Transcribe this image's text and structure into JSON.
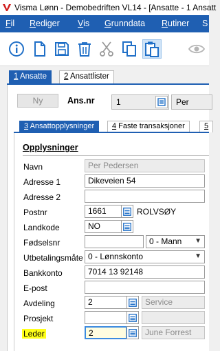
{
  "window": {
    "title": "Visma Lønn - Demobedriften VL14 - [Ansatte - 1 Ansatt"
  },
  "menu": [
    {
      "label": "il",
      "u": "F"
    },
    {
      "label": "ediger",
      "u": "R"
    },
    {
      "label": "is",
      "u": "V"
    },
    {
      "label": "runndata",
      "u": "G"
    },
    {
      "label": "utiner",
      "u": "R"
    },
    {
      "label": "S",
      "u": ""
    }
  ],
  "toolbar": {
    "icons": [
      "info-icon",
      "new-document-icon",
      "save-icon",
      "delete-icon",
      "cut-icon",
      "copy-icon",
      "paste-icon",
      "view-icon"
    ]
  },
  "tabs": [
    {
      "num": "1",
      "label": " Ansatte"
    },
    {
      "num": "2",
      "label": " Ansattlister"
    }
  ],
  "employee": {
    "new_button": "Ny",
    "ansnr_label": "Ans.nr",
    "ansnr_value": "1",
    "name_preview": "Per"
  },
  "subtabs": [
    {
      "num": "3",
      "label": " Ansattopplysninger"
    },
    {
      "num": "4",
      "label": " Faste transaksjoner"
    },
    {
      "num": "5",
      "label": ""
    }
  ],
  "section_title": "Opplysninger",
  "fields": {
    "navn": {
      "label": "Navn",
      "value": "Per Pedersen"
    },
    "adresse1": {
      "label": "Adresse 1",
      "value": "Dikeveien 54"
    },
    "adresse2": {
      "label": "Adresse 2",
      "value": ""
    },
    "postnr": {
      "label": "Postnr",
      "value": "1661",
      "place": "ROLVSØY"
    },
    "landkode": {
      "label": "Landkode",
      "value": "NO"
    },
    "fodselsnr": {
      "label": "Fødselsnr",
      "value": "",
      "gender": "0 - Mann"
    },
    "utbetaling": {
      "label": "Utbetalingsmåte",
      "value": "0 - Lønnskonto"
    },
    "bankkonto": {
      "label": "Bankkonto",
      "value": "7014 13 92148"
    },
    "epost": {
      "label": "E-post",
      "value": ""
    },
    "avdeling": {
      "label": "Avdeling",
      "value": "2",
      "name": "Service"
    },
    "prosjekt": {
      "label": "Prosjekt",
      "value": ""
    },
    "leder": {
      "label": "Leder",
      "value": "2",
      "name": "June Forrest"
    }
  },
  "colors": {
    "accent": "#1f5fb2",
    "highlight": "#ffff1a",
    "focus": "#3c8be0"
  }
}
